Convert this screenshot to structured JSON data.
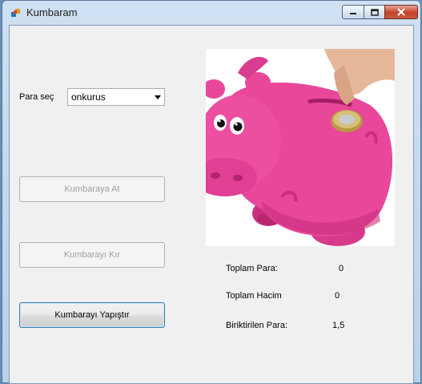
{
  "window": {
    "title": "Kumbaram"
  },
  "form": {
    "coin_label": "Para seç",
    "coin_select": {
      "value": "onkurus"
    },
    "buttons": {
      "deposit": "Kumbaraya At",
      "break": "Kumbarayı Kır",
      "glue": "Kumbarayı Yapıştır"
    },
    "stats": {
      "total_money_label": "Toplam Para:",
      "total_money_value": "0",
      "total_volume_label": "Toplam Hacim",
      "total_volume_value": "0",
      "stored_label": "Biriktirilen Para:",
      "stored_value": "1,5"
    }
  },
  "image": {
    "subject": "pink-piggy-bank-with-coin"
  },
  "colors": {
    "piggy": "#e8479a",
    "piggy_shadow": "#c92f7f",
    "close_button": "#c2412a"
  }
}
